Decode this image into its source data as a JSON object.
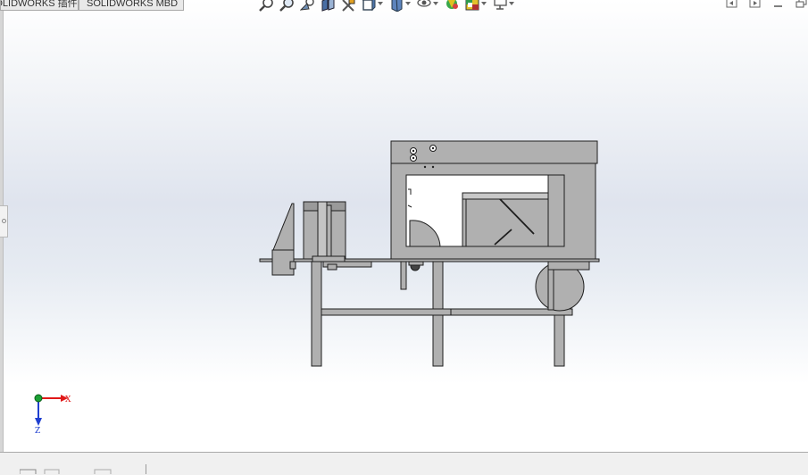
{
  "tabs": [
    {
      "label": "SOLIDWORKS 插件"
    },
    {
      "label": "SOLIDWORKS MBD"
    }
  ],
  "view_toolbar": {
    "icons": [
      "zoom-to-fit-icon",
      "zoom-area-icon",
      "previous-view-icon",
      "section-view-icon",
      "dynamic-annotation-icon",
      "view-orientation-icon",
      "display-style-icon",
      "hide-show-icon",
      "edit-appearance-icon",
      "apply-scene-icon",
      "view-settings-icon"
    ]
  },
  "triad": {
    "x_label": "X",
    "z_label": "Z"
  },
  "colors": {
    "model_fill": "#b0b0b0",
    "model_stroke": "#1e1e1e",
    "axis_x": "#e01818",
    "axis_z": "#1f3fd0",
    "origin": "#1aa033"
  }
}
